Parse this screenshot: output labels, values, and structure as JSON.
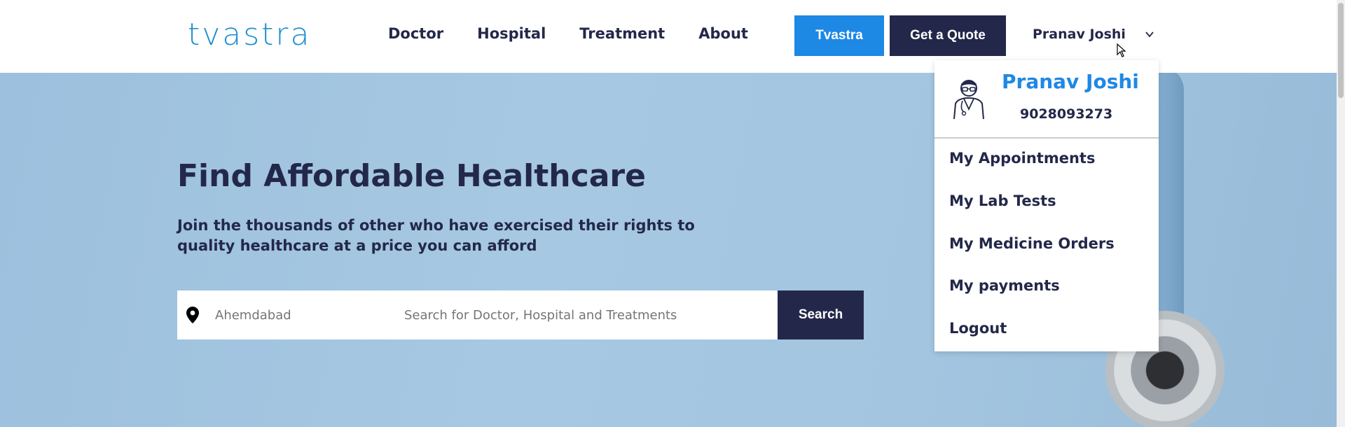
{
  "brand": {
    "logo_text": "tvastra",
    "accent": "#1e88e5",
    "dark": "#23284a"
  },
  "nav": {
    "items": [
      "Doctor",
      "Hospital",
      "Treatment",
      "About"
    ]
  },
  "header": {
    "tvastra_button": "Tvastra",
    "quote_button": "Get a Quote",
    "user_name": "Pranav Joshi"
  },
  "hero": {
    "title": "Find Affordable Healthcare",
    "subtitle": "Join the thousands of other who have exercised their rights to quality healthcare at a price you can afford"
  },
  "search": {
    "location_placeholder": "Ahemdabad",
    "query_placeholder": "Search for Doctor, Hospital and Treatments",
    "button_label": "Search"
  },
  "dropdown": {
    "name": "Pranav Joshi",
    "phone": "9028093273",
    "items": [
      "My Appointments",
      "My Lab Tests",
      "My Medicine Orders",
      "My payments",
      "Logout"
    ]
  }
}
